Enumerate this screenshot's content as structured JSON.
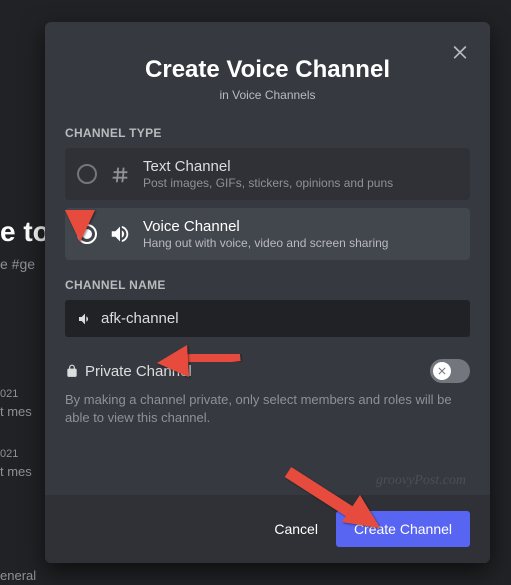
{
  "bg": {
    "t1": "e to",
    "t2": "e #ge",
    "t3": "021",
    "t4": "t mes",
    "t5": "021",
    "t6": "t mes",
    "t7": "eneral"
  },
  "header": {
    "title": "Create Voice Channel",
    "subtitle": "in Voice Channels"
  },
  "sections": {
    "channel_type_label": "CHANNEL TYPE",
    "channel_name_label": "CHANNEL NAME"
  },
  "types": {
    "text": {
      "title": "Text Channel",
      "desc": "Post images, GIFs, stickers, opinions and puns"
    },
    "voice": {
      "title": "Voice Channel",
      "desc": "Hang out with voice, video and screen sharing"
    }
  },
  "name_input": {
    "value": "afk-channel"
  },
  "private": {
    "label": "Private Channel",
    "desc": "By making a channel private, only select members and roles will be able to view this channel."
  },
  "footer": {
    "cancel": "Cancel",
    "create": "Create Channel"
  },
  "watermark": "groovyPost.com"
}
